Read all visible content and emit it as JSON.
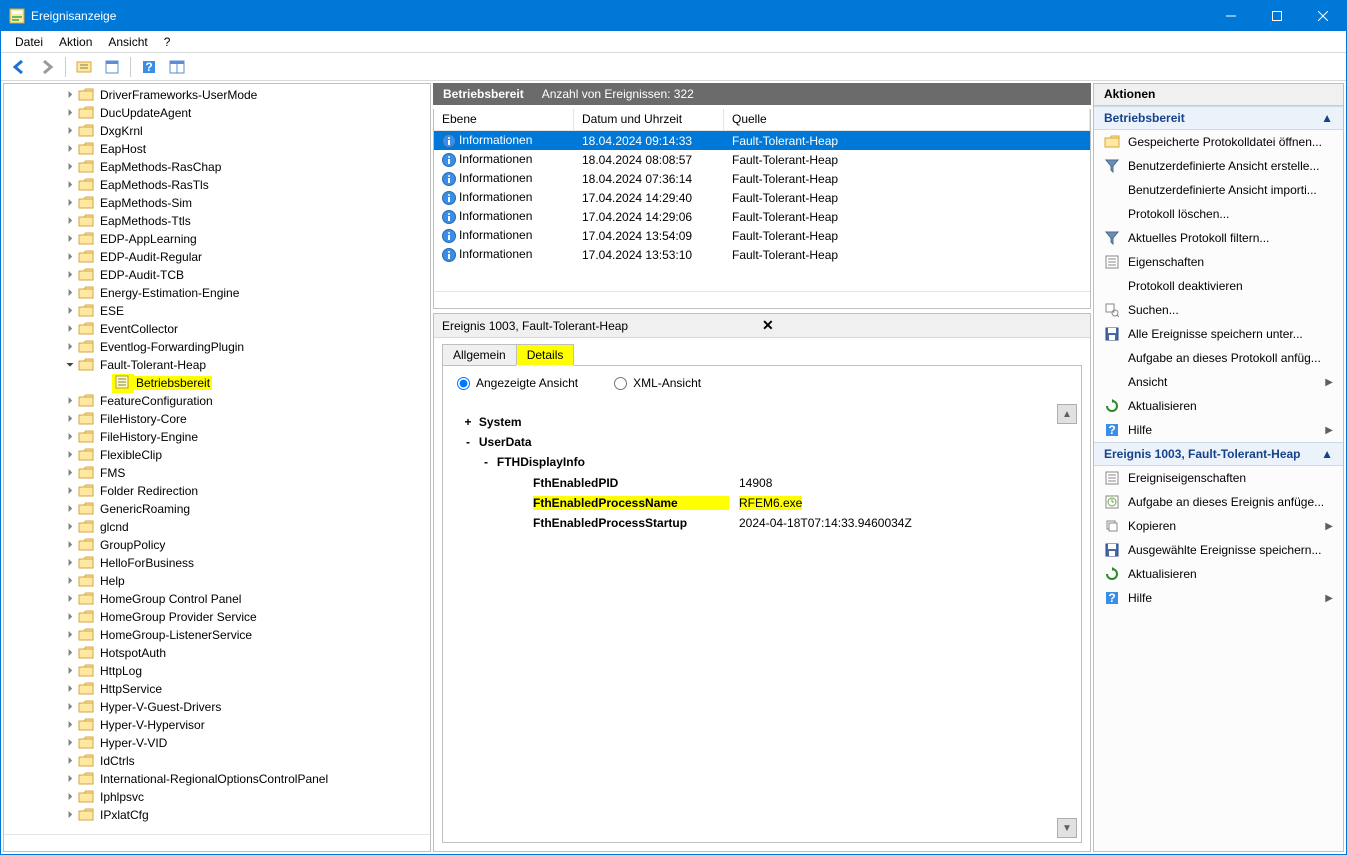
{
  "window": {
    "title": "Ereignisanzeige"
  },
  "menu": {
    "datei": "Datei",
    "aktion": "Aktion",
    "ansicht": "Ansicht",
    "help": "?"
  },
  "tree": {
    "items": [
      {
        "label": "DriverFrameworks-UserMode"
      },
      {
        "label": "DucUpdateAgent"
      },
      {
        "label": "DxgKrnl"
      },
      {
        "label": "EapHost"
      },
      {
        "label": "EapMethods-RasChap"
      },
      {
        "label": "EapMethods-RasTls"
      },
      {
        "label": "EapMethods-Sim"
      },
      {
        "label": "EapMethods-Ttls"
      },
      {
        "label": "EDP-AppLearning"
      },
      {
        "label": "EDP-Audit-Regular"
      },
      {
        "label": "EDP-Audit-TCB"
      },
      {
        "label": "Energy-Estimation-Engine"
      },
      {
        "label": "ESE"
      },
      {
        "label": "EventCollector"
      },
      {
        "label": "Eventlog-ForwardingPlugin"
      },
      {
        "label": "Fault-Tolerant-Heap",
        "open": true
      },
      {
        "label": "Betriebsbereit",
        "child": true,
        "highlight": true
      },
      {
        "label": "FeatureConfiguration"
      },
      {
        "label": "FileHistory-Core"
      },
      {
        "label": "FileHistory-Engine"
      },
      {
        "label": "FlexibleClip"
      },
      {
        "label": "FMS"
      },
      {
        "label": "Folder Redirection"
      },
      {
        "label": "GenericRoaming"
      },
      {
        "label": "glcnd"
      },
      {
        "label": "GroupPolicy"
      },
      {
        "label": "HelloForBusiness"
      },
      {
        "label": "Help"
      },
      {
        "label": "HomeGroup Control Panel"
      },
      {
        "label": "HomeGroup Provider Service"
      },
      {
        "label": "HomeGroup-ListenerService"
      },
      {
        "label": "HotspotAuth"
      },
      {
        "label": "HttpLog"
      },
      {
        "label": "HttpService"
      },
      {
        "label": "Hyper-V-Guest-Drivers"
      },
      {
        "label": "Hyper-V-Hypervisor"
      },
      {
        "label": "Hyper-V-VID"
      },
      {
        "label": "IdCtrls"
      },
      {
        "label": "International-RegionalOptionsControlPanel"
      },
      {
        "label": "Iphlpsvc"
      },
      {
        "label": "IPxlatCfg"
      }
    ]
  },
  "grid": {
    "header_title": "Betriebsbereit",
    "header_count": "Anzahl von Ereignissen: 322",
    "cols": {
      "ebene": "Ebene",
      "datum": "Datum und Uhrzeit",
      "quelle": "Quelle"
    },
    "rows": [
      {
        "level": "Informationen",
        "date": "18.04.2024 09:14:33",
        "source": "Fault-Tolerant-Heap",
        "selected": true
      },
      {
        "level": "Informationen",
        "date": "18.04.2024 08:08:57",
        "source": "Fault-Tolerant-Heap"
      },
      {
        "level": "Informationen",
        "date": "18.04.2024 07:36:14",
        "source": "Fault-Tolerant-Heap"
      },
      {
        "level": "Informationen",
        "date": "17.04.2024 14:29:40",
        "source": "Fault-Tolerant-Heap"
      },
      {
        "level": "Informationen",
        "date": "17.04.2024 14:29:06",
        "source": "Fault-Tolerant-Heap"
      },
      {
        "level": "Informationen",
        "date": "17.04.2024 13:54:09",
        "source": "Fault-Tolerant-Heap"
      },
      {
        "level": "Informationen",
        "date": "17.04.2024 13:53:10",
        "source": "Fault-Tolerant-Heap"
      }
    ]
  },
  "detail": {
    "title": "Ereignis 1003, Fault-Tolerant-Heap",
    "tabs": {
      "allgemein": "Allgemein",
      "details": "Details"
    },
    "radio": {
      "friendly": "Angezeigte Ansicht",
      "xml": "XML-Ansicht"
    },
    "nodes": {
      "system": "System",
      "userdata": "UserData",
      "fth": "FTHDisplayInfo"
    },
    "kv": {
      "pid_k": "FthEnabledPID",
      "pid_v": "14908",
      "pname_k": "FthEnabledProcessName",
      "pname_v": "RFEM6.exe",
      "pstart_k": "FthEnabledProcessStartup",
      "pstart_v": "2024-04-18T07:14:33.9460034Z"
    }
  },
  "actions": {
    "title": "Aktionen",
    "section1": "Betriebsbereit",
    "items1": [
      {
        "icon": "open",
        "label": "Gespeicherte Protokolldatei öffnen..."
      },
      {
        "icon": "filter",
        "label": "Benutzerdefinierte Ansicht erstelle..."
      },
      {
        "icon": "none",
        "label": "Benutzerdefinierte Ansicht importi..."
      },
      {
        "icon": "none",
        "label": "Protokoll löschen..."
      },
      {
        "icon": "filter",
        "label": "Aktuelles Protokoll filtern..."
      },
      {
        "icon": "props",
        "label": "Eigenschaften"
      },
      {
        "icon": "none",
        "label": "Protokoll deaktivieren"
      },
      {
        "icon": "find",
        "label": "Suchen..."
      },
      {
        "icon": "save",
        "label": "Alle Ereignisse speichern unter..."
      },
      {
        "icon": "none",
        "label": "Aufgabe an dieses Protokoll anfüg..."
      },
      {
        "icon": "none",
        "label": "Ansicht",
        "sub": true
      },
      {
        "icon": "refresh",
        "label": "Aktualisieren"
      },
      {
        "icon": "help",
        "label": "Hilfe",
        "sub": true
      }
    ],
    "section2": "Ereignis 1003, Fault-Tolerant-Heap",
    "items2": [
      {
        "icon": "props",
        "label": "Ereigniseigenschaften"
      },
      {
        "icon": "task",
        "label": "Aufgabe an dieses Ereignis anfüge..."
      },
      {
        "icon": "copy",
        "label": "Kopieren",
        "sub": true
      },
      {
        "icon": "save",
        "label": "Ausgewählte Ereignisse speichern..."
      },
      {
        "icon": "refresh",
        "label": "Aktualisieren"
      },
      {
        "icon": "help",
        "label": "Hilfe",
        "sub": true
      }
    ]
  }
}
